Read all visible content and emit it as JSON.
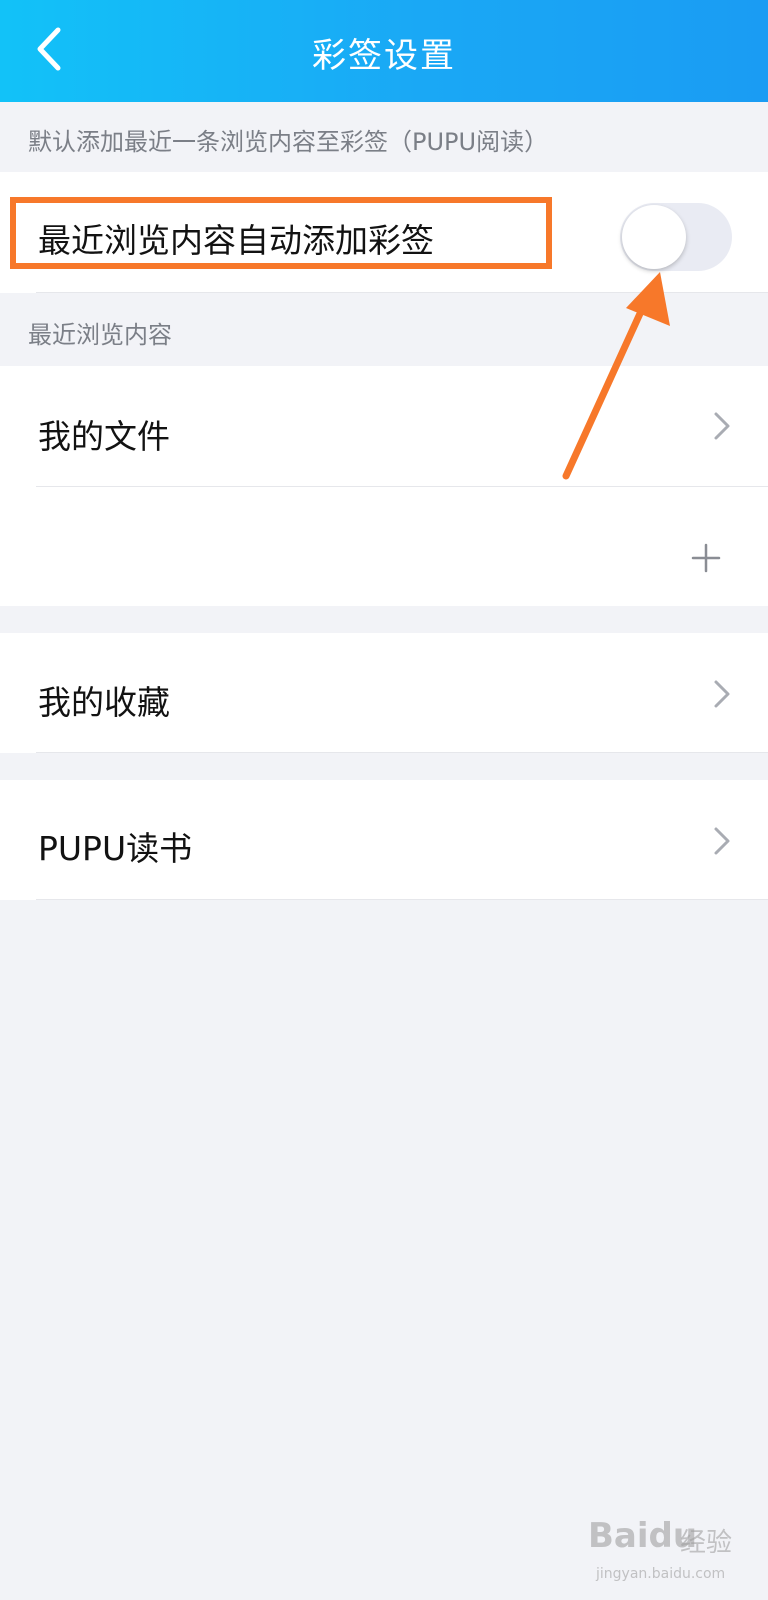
{
  "header": {
    "title": "彩签设置",
    "back_icon": "chevron-left-icon"
  },
  "auto_add_section": {
    "caption": "默认添加最近一条浏览内容至彩签（PUPU阅读）",
    "toggle_row": {
      "label": "最近浏览内容自动添加彩签",
      "toggle_on": false
    }
  },
  "recent_section": {
    "caption": "最近浏览内容",
    "items": [
      {
        "label": "我的文件",
        "icon": "chevron-right-icon"
      }
    ],
    "add_row": {
      "icon": "plus-icon"
    }
  },
  "other_items": [
    {
      "label": "我的收藏",
      "icon": "chevron-right-icon"
    },
    {
      "label": "PUPU读书",
      "icon": "chevron-right-icon"
    }
  ],
  "annotation": {
    "highlight_color": "#f7782a",
    "arrow_color": "#f7782a"
  },
  "watermark": {
    "logo": "Baidu",
    "text": "经验",
    "url": "jingyan.baidu.com"
  },
  "colors": {
    "header_gradient_start": "#12c2f8",
    "header_gradient_end": "#1a9cf3",
    "background": "#f2f3f7"
  }
}
